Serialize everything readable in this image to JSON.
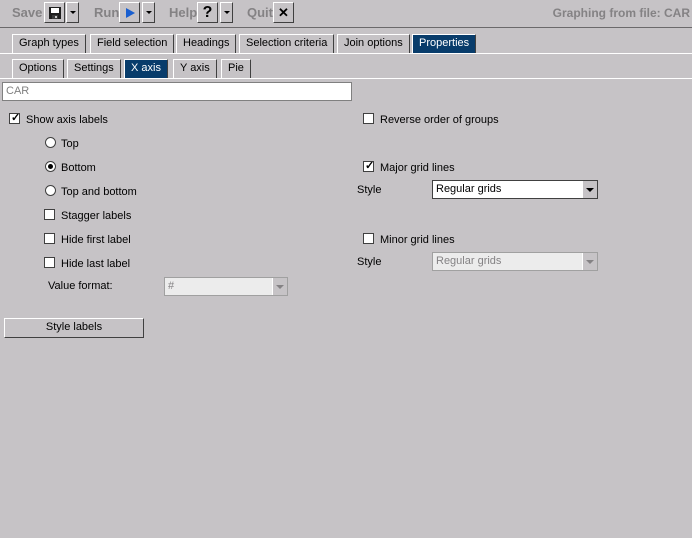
{
  "toolbar": {
    "save_label": "Save",
    "run_label": "Run",
    "help_label": "Help",
    "quit_label": "Quit",
    "help_glyph": "?",
    "quit_glyph": "✕",
    "save_icon": "floppy-disk-icon",
    "run_icon": "play-icon"
  },
  "window_title": "Graphing from file: CAR",
  "tabs_main": [
    {
      "label": "Graph types",
      "active": false
    },
    {
      "label": "Field selection",
      "active": false
    },
    {
      "label": "Headings",
      "active": false
    },
    {
      "label": "Selection criteria",
      "active": false
    },
    {
      "label": "Join options",
      "active": false
    },
    {
      "label": "Properties",
      "active": true
    }
  ],
  "tabs_sub": [
    {
      "label": "Options",
      "active": false
    },
    {
      "label": "Settings",
      "active": false
    },
    {
      "label": "X axis",
      "active": true
    },
    {
      "label": "Y axis",
      "active": false
    },
    {
      "label": "Pie",
      "active": false
    }
  ],
  "axis_field": {
    "value": "CAR"
  },
  "left": {
    "show_axis_labels": {
      "label": "Show axis labels",
      "checked": true
    },
    "position_options": [
      {
        "label": "Top",
        "selected": false
      },
      {
        "label": "Bottom",
        "selected": true
      },
      {
        "label": "Top and bottom",
        "selected": false
      }
    ],
    "stagger_labels": {
      "label": "Stagger labels",
      "checked": false
    },
    "hide_first_label": {
      "label": "Hide first label",
      "checked": false
    },
    "hide_last_label": {
      "label": "Hide last label",
      "checked": false
    },
    "value_format": {
      "label": "Value format:",
      "value": "#"
    }
  },
  "right": {
    "reverse_order": {
      "label": "Reverse order of groups",
      "checked": false
    },
    "major_grid": {
      "label": "Major grid lines",
      "checked": true
    },
    "major_style": {
      "label": "Style",
      "value": "Regular grids"
    },
    "minor_grid": {
      "label": "Minor grid lines",
      "checked": false
    },
    "minor_style": {
      "label": "Style",
      "value": "Regular grids"
    }
  },
  "style_labels_button": "Style labels",
  "colors": {
    "active_tab": "#083c6b",
    "background": "#c6c3c6",
    "run_icon": "#1a5fd0"
  }
}
